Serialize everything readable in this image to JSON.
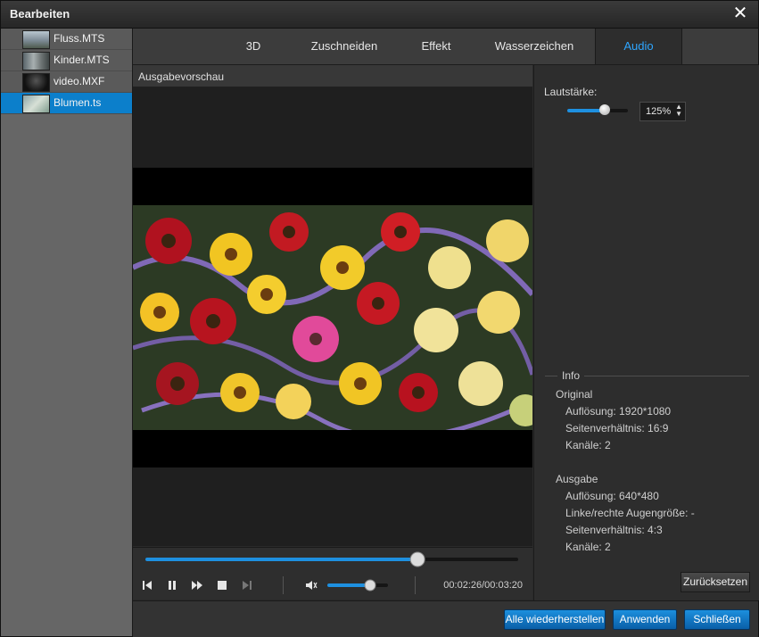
{
  "window": {
    "title": "Bearbeiten",
    "close_glyph": "✕"
  },
  "files": [
    {
      "label": "Fluss.MTS",
      "selected": false
    },
    {
      "label": "Kinder.MTS",
      "selected": false
    },
    {
      "label": "video.MXF",
      "selected": false
    },
    {
      "label": "Blumen.ts",
      "selected": true
    }
  ],
  "tabs": [
    "3D",
    "Zuschneiden",
    "Effekt",
    "Wasserzeichen",
    "Audio"
  ],
  "active_tab": "Audio",
  "preview": {
    "header": "Ausgabevorschau"
  },
  "player": {
    "time": "00:02:26/00:03:20",
    "seek_fraction": 0.73,
    "volume_fraction": 0.75
  },
  "audio": {
    "volume_label": "Lautstärke:",
    "volume_value": "125%",
    "volume_fraction": 0.62
  },
  "info": {
    "legend": "Info",
    "original_heading": "Original",
    "original_resolution": "Auflösung: 1920*1080",
    "original_aspect": "Seitenverhältnis: 16:9",
    "original_channels": "Kanäle: 2",
    "output_heading": "Ausgabe",
    "output_resolution": "Auflösung: 640*480",
    "output_eye": "Linke/rechte Augengröße: -",
    "output_aspect": "Seitenverhältnis: 4:3",
    "output_channels": "Kanäle: 2"
  },
  "buttons": {
    "reset": "Zurücksetzen",
    "restore_all": "Alle wiederherstellen",
    "apply": "Anwenden",
    "close": "Schließen"
  },
  "colors": {
    "accent": "#1e90e0",
    "selected_file": "#0c7fcb",
    "active_tab_text": "#2ea6ff"
  }
}
